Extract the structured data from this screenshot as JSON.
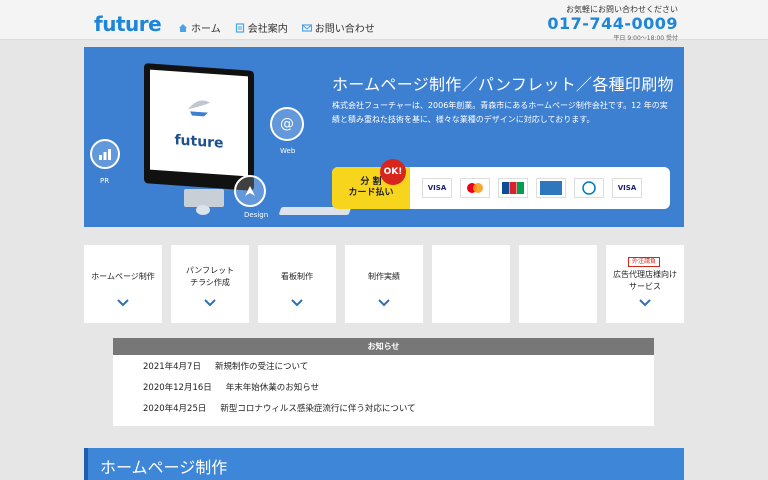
{
  "header": {
    "logo": "future",
    "nav": [
      {
        "label": "ホーム",
        "icon": "home-icon"
      },
      {
        "label": "会社案内",
        "icon": "document-icon"
      },
      {
        "label": "お問い合わせ",
        "icon": "mail-icon"
      }
    ],
    "contact_lead": "お気軽にお問い合わせください",
    "phone": "017-744-0009",
    "hours": "平日 9:00～18:00 受付"
  },
  "hero": {
    "title": "ホームページ制作／パンフレット／各種印刷物",
    "desc": "株式会社フューチャーは、2006年創業。青森市にあるホームページ制作会社です。12 年の実績と積み重ねた技術を基に、様々な業種のデザインに対応しております。",
    "screen_logo": "future",
    "bubbles": {
      "web": "Web",
      "pr": "PR",
      "design": "Design"
    },
    "payment_label_line1": "分 割",
    "payment_label_line2": "カード払い",
    "ok_badge": "OK!",
    "card_logos": [
      "visa",
      "mastercard",
      "jcb",
      "amex",
      "diners-club",
      "visa"
    ]
  },
  "colors": {
    "brand": "#1e86d8",
    "hero_bg": "#3d7fd1",
    "accent_yellow": "#f7d51d",
    "badge_red": "#d9261c"
  },
  "tiles": [
    {
      "label": "ホームページ制作",
      "badge": ""
    },
    {
      "label": "パンフレット\nチラシ作成",
      "badge": ""
    },
    {
      "label": "看板制作",
      "badge": ""
    },
    {
      "label": "制作実績",
      "badge": ""
    },
    {
      "label": "",
      "badge": ""
    },
    {
      "label": "",
      "badge": ""
    },
    {
      "label": "広告代理店様向け\nサービス",
      "badge": "外注請負"
    }
  ],
  "news": {
    "heading": "お知らせ",
    "items": [
      {
        "date": "2021年4月7日",
        "title": "新規制作の受注について"
      },
      {
        "date": "2020年12月16日",
        "title": "年末年始休業のお知らせ"
      },
      {
        "date": "2020年4月25日",
        "title": "新型コロナウィルス感染症流行に伴う対応について"
      }
    ]
  },
  "section": {
    "title": "ホームページ制作"
  }
}
